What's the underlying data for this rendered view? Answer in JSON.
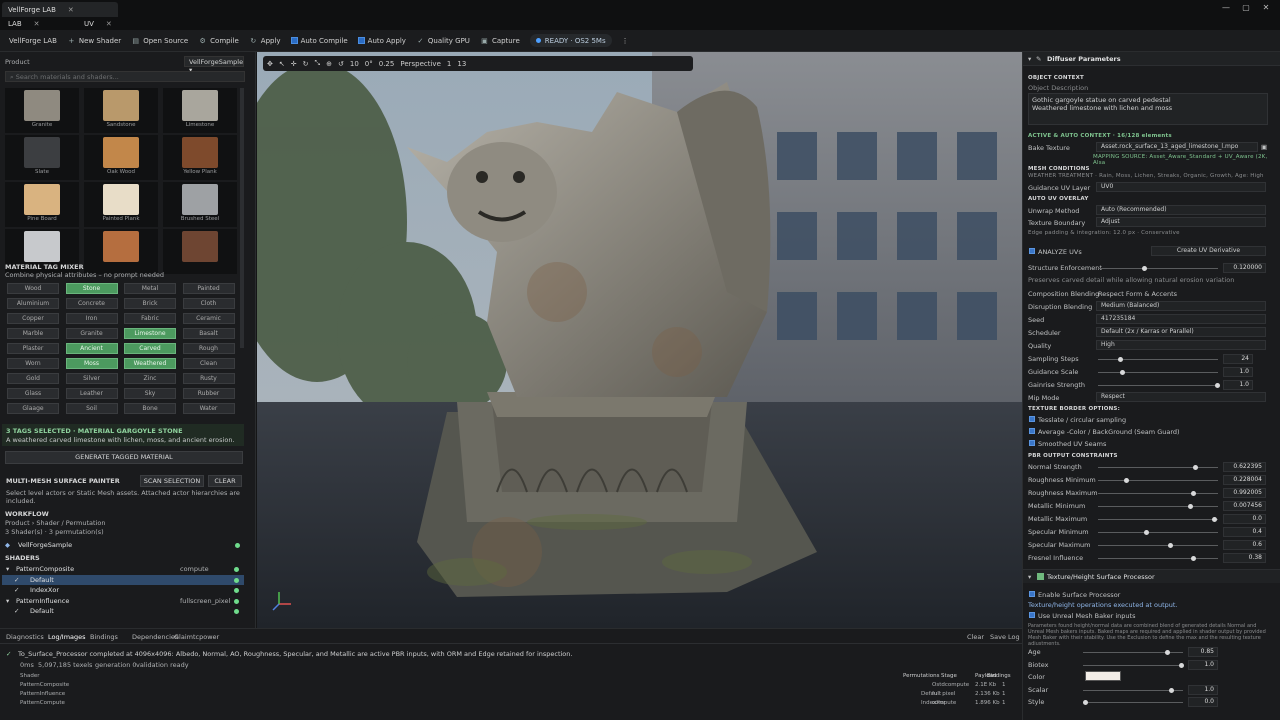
{
  "titlebar": {
    "tabs": [
      {
        "label": "VellForge LAB",
        "close": "✕"
      },
      {
        "label": "LAB",
        "close": "✕"
      },
      {
        "label": "UV",
        "close": "✕"
      }
    ],
    "window_controls": [
      "—",
      "▢",
      "✕"
    ]
  },
  "toolbar": {
    "app_name": "VellForge LAB",
    "new_shader": "New Shader",
    "open_source": "Open Source",
    "compile": "Compile",
    "apply": "Apply",
    "auto_compile": "Auto Compile",
    "auto_apply": "Auto Apply",
    "quality_gpu": "Quality GPU",
    "capture": "Capture",
    "status": "READY · OS2 5Ms"
  },
  "left": {
    "product_label": "Product",
    "product_value": "VellForgeSample",
    "search_placeholder": "Search materials and shaders...",
    "materials": [
      {
        "name": "Granite",
        "color": "#8f8a80"
      },
      {
        "name": "Sandstone",
        "color": "#b9996b"
      },
      {
        "name": "Limestone",
        "color": "#a9a69d"
      },
      {
        "name": "Slate",
        "color": "#3c3e41"
      },
      {
        "name": "Oak Wood",
        "color": "#c2874a"
      },
      {
        "name": "Yellow Plank",
        "color": "#7e4a2c"
      },
      {
        "name": "Pine Board",
        "color": "#d9b380"
      },
      {
        "name": "Painted Plank",
        "color": "#e8ddc8"
      },
      {
        "name": "Brushed Steel",
        "color": "#9ea1a4"
      },
      {
        "name": "",
        "color": "#c7c9cc"
      },
      {
        "name": "",
        "color": "#b56e3f"
      },
      {
        "name": "",
        "color": "#6e4532"
      }
    ],
    "tag_mixer_title": "MATERIAL TAG MIXER",
    "tag_mixer_sub": "Combine physical attributes – no prompt needed",
    "tags": [
      {
        "label": "Wood",
        "on": false
      },
      {
        "label": "Stone",
        "on": true
      },
      {
        "label": "Metal",
        "on": false
      },
      {
        "label": "Painted",
        "on": false
      },
      {
        "label": "Aluminium",
        "on": false
      },
      {
        "label": "Concrete",
        "on": false
      },
      {
        "label": "Brick",
        "on": false
      },
      {
        "label": "Cloth",
        "on": false
      },
      {
        "label": "Copper",
        "on": false
      },
      {
        "label": "Iron",
        "on": false
      },
      {
        "label": "Fabric",
        "on": false
      },
      {
        "label": "Ceramic",
        "on": false
      },
      {
        "label": "Marble",
        "on": false
      },
      {
        "label": "Granite",
        "on": false
      },
      {
        "label": "Limestone",
        "on": true
      },
      {
        "label": "Basalt",
        "on": false
      },
      {
        "label": "Plaster",
        "on": false
      },
      {
        "label": "Ancient",
        "on": true
      },
      {
        "label": "Carved",
        "on": true
      },
      {
        "label": "Rough",
        "on": false
      },
      {
        "label": "Worn",
        "on": false
      },
      {
        "label": "Moss",
        "on": true
      },
      {
        "label": "Weathered",
        "on": true
      },
      {
        "label": "Clean",
        "on": false
      },
      {
        "label": "Gold",
        "on": false
      },
      {
        "label": "Silver",
        "on": false
      },
      {
        "label": "Zinc",
        "on": false
      },
      {
        "label": "Rusty",
        "on": false
      },
      {
        "label": "Glass",
        "on": false
      },
      {
        "label": "Leather",
        "on": false
      },
      {
        "label": "Sky",
        "on": false
      },
      {
        "label": "Rubber",
        "on": false
      },
      {
        "label": "Glaage",
        "on": false
      },
      {
        "label": "Soil",
        "on": false
      },
      {
        "label": "Bone",
        "on": false
      },
      {
        "label": "Water",
        "on": false
      }
    ],
    "tags_selected": "3 TAGS SELECTED · MATERIAL GARGOYLE STONE",
    "tags_desc": "A weathered carved limestone with lichen, moss, and ancient erosion.",
    "generate_button": "GENERATE TAGGED MATERIAL",
    "painter_title": "MULTI-MESH SURFACE PAINTER",
    "scan_button": "SCAN SELECTION",
    "clear_button": "CLEAR",
    "painter_desc": "Select level actors or Static Mesh assets. Attached actor hierarchies are included.",
    "workflow_title": "WORKFLOW",
    "workflow_line1": "Product › Shader / Permutation",
    "workflow_line2": "3 Shader(s) · 3 permutation(s)",
    "sample_name": "VellForgeSample",
    "shaders_title": "SHADERS",
    "shaders": [
      {
        "name": "PatternComposite",
        "kind": "compute",
        "indent": 0
      },
      {
        "name": "Default",
        "kind": "",
        "indent": 1
      },
      {
        "name": "IndexXor",
        "kind": "",
        "indent": 1
      },
      {
        "name": "PatternInfluence",
        "kind": "fullscreen_pixel",
        "indent": 0
      },
      {
        "name": "Default",
        "kind": "",
        "indent": 1
      }
    ]
  },
  "viewport": {
    "tools": [
      "✥",
      "↖",
      "✛",
      "↻",
      "⤡",
      "⊕",
      "↺",
      "10",
      "0°",
      "0.25",
      "Perspective",
      "1",
      "13"
    ]
  },
  "right": {
    "panel_title": "Diffuser Parameters",
    "object_context": "OBJECT CONTEXT",
    "object_desc_label": "Object Description",
    "object_desc": "Gothic gargoyle statue on carved pedestal\nWeathered limestone with lichen and moss",
    "active_context": "ACTIVE & AUTO CONTEXT · 16/128 elements",
    "bake_texture_label": "Bake Texture",
    "bake_texture_value": "Asset.rock_surface_13_aged_limestone_l.mpo",
    "mapping_source": "MAPPING SOURCE:  Asset_Aware_Standard + UV_Aware (2K, Alsa",
    "mesh_conditions": "MESH CONDITIONS",
    "weather_treatment": "WEATHER TREATMENT  ·  Rain, Moss, Lichen, Streaks, Organic, Growth, Age: High",
    "guidance_uv_label": "Guidance UV Layer",
    "guidance_uv_value": "UV0",
    "auto_uv_overlay": "AUTO UV OVERLAY",
    "unwrap_method_label": "Unwrap Method",
    "unwrap_method_value": "Auto (Recommended)",
    "texture_boundary_label": "Texture Boundary",
    "texture_boundary_value": "Adjust",
    "edge_padding": "Edge padding & integration: 12.0 px · Conservative",
    "analyze_uvs": "ANALYZE UVs",
    "create_uv_derivative": "Create UV Derivative",
    "structure_enforcement_label": "Structure Enforcement",
    "structure_enforcement_value": "0.120000",
    "structure_enforcement_level": 0.12,
    "structure_note": "Preserves carved detail while allowing natural erosion variation",
    "composition_blending_label": "Composition Blending",
    "composition_blending_value": "Respect Form & Accents",
    "disruption_blending_label": "Disruption Blending",
    "disruption_blending_value": "Medium (Balanced)",
    "seed_label": "Seed",
    "seed_value": "417235184",
    "scheduler_label": "Scheduler",
    "scheduler_value": "Default (2x / Karras or Parallel)",
    "quality_label": "Quality",
    "quality_value": "High",
    "sampling_steps_label": "Sampling Steps",
    "sampling_steps_value": "24",
    "guidance_scale_label": "Guidance Scale",
    "guidance_scale_value": "1.0",
    "gainrise_label": "Gainrise Strength",
    "gainrise_value": "1.0",
    "mip_mode_label": "Mip Mode",
    "mip_mode_value": "Respect",
    "texture_border_options": "TEXTURE BORDER OPTIONS:",
    "tex_opt1": "Tesslate / circular sampling",
    "tex_opt2": "Average -Color / BackGround (Seam Guard)",
    "tex_opt3": "Smoothed UV Seams",
    "pbr_constraints": "PBR OUTPUT CONSTRAINTS",
    "pbr": [
      {
        "label": "Normal Strength",
        "value": "0.622395",
        "level": 0.82
      },
      {
        "label": "Roughness Minimum",
        "value": "0.228004",
        "level": 0.22
      },
      {
        "label": "Roughness Maximum",
        "value": "0.992005",
        "level": 0.8
      },
      {
        "label": "Metallic Minimum",
        "value": "0.007456",
        "level": 0.78
      },
      {
        "label": "Metallic Maximum",
        "value": "0.0",
        "level": 0.98
      },
      {
        "label": "Specular Minimum",
        "value": "0.4",
        "level": 0.4
      },
      {
        "label": "Specular Maximum",
        "value": "0.6",
        "level": 0.6
      },
      {
        "label": "Fresnel Influence",
        "value": "0.38",
        "level": 0.8
      }
    ],
    "height_processor_title": "Texture/Height Surface Processor",
    "enable_surface": "Enable Surface Processor",
    "surface_note": "Texture/height operations executed at output.",
    "use_unreal_baker": "Use Unreal Mesh Baker inputs",
    "processor_desc": "Parameters found height/normal data are combined blend of generated details Normal and Unreal Mesh bakers inputs. Baked maps are required and applied in shader output by provided Mesh Baker with their stability. Use the Exclusion to define the max and the resulting texture adjustments.",
    "props": [
      {
        "label": "Age",
        "value": "0.85",
        "level": 0.85
      },
      {
        "label": "Biotex",
        "value": "1.0",
        "level": 1.0
      },
      {
        "label": "Color",
        "value": "",
        "level": 0
      },
      {
        "label": "Scalar",
        "value": "1.0",
        "level": 0.9
      },
      {
        "label": "Style",
        "value": "0.0",
        "level": 0.0
      }
    ],
    "color_swatch": "#f3eee8"
  },
  "bottom": {
    "tabs": [
      "Diagnostics",
      "Log/Images",
      "Bindings",
      "Dependencies",
      "Glaimtcpower"
    ],
    "clear": "Clear",
    "save_log": "Save Log",
    "log_line": "To_Surface_Processor completed at 4096x4096: Albedo, Normal, AO, Roughness, Specular, and Metallic are active PBR inputs, with ORM and Edge retained for inspection.",
    "stats": [
      "0ms",
      "5,097,185 texels",
      "generation 0",
      "validation ready"
    ],
    "shader_header": "Shader",
    "shader_list": [
      "PatternComposite",
      "PatternInfluence",
      "PatternCompute"
    ],
    "table_headers": [
      "Permutations",
      "Stage",
      "Payload",
      "Bindings"
    ],
    "table_rows": [
      [
        "",
        "Ostdcompute",
        "2.1Ε Kb",
        "1"
      ],
      [
        "Default",
        "full pixel",
        "2.136 Kb",
        "1"
      ],
      [
        "IndexXor",
        "compute",
        "1.896 Kb",
        "1"
      ]
    ]
  }
}
